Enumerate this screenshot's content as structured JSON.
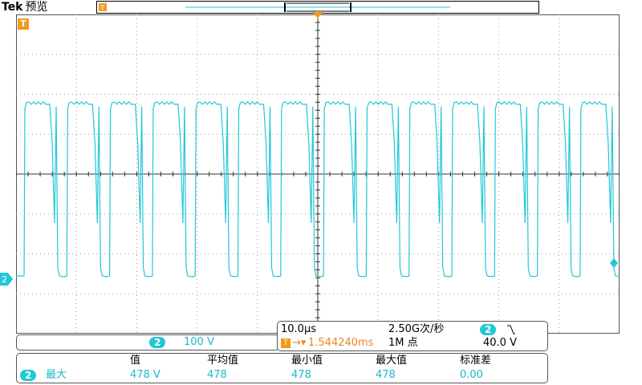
{
  "header": {
    "brand": "Tek",
    "mode": "预览"
  },
  "colors": {
    "ch2": "#22c8d6",
    "trigger": "#f29a1e",
    "grid": "#555555",
    "bg": "#ffffff"
  },
  "markers": {
    "ch2": "2",
    "trigger": "T"
  },
  "channel": {
    "badge": "2",
    "scale": "100 V"
  },
  "horizontal": {
    "timebase": "10.0µs",
    "sample_rate": "2.50G次/秒",
    "trigger_pos": "1.544240ms",
    "record": "1M 点",
    "trig_ch": "2",
    "trig_level": "40.0 V"
  },
  "measure": {
    "badge": "2",
    "name": "最大",
    "headers": [
      "值",
      "平均值",
      "最小值",
      "最大值",
      "标准差"
    ],
    "values": [
      "478 V",
      "478",
      "478",
      "478",
      "0.00"
    ]
  }
}
